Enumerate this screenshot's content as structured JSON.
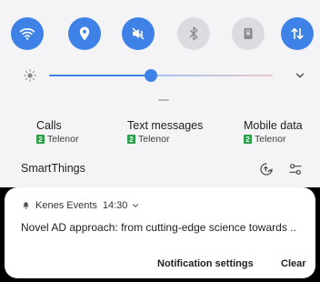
{
  "quick_toggles": [
    {
      "icon": "wifi-icon",
      "state": "on"
    },
    {
      "icon": "location-icon",
      "state": "on"
    },
    {
      "icon": "mute-icon",
      "state": "on"
    },
    {
      "icon": "bluetooth-icon",
      "state": "off"
    },
    {
      "icon": "lock-icon",
      "state": "off"
    },
    {
      "icon": "data-transfer-icon",
      "state": "on"
    }
  ],
  "brightness": {
    "level": 0.45
  },
  "carriers": [
    {
      "title": "Calls",
      "sim": "2",
      "network": "Telenor"
    },
    {
      "title": "Text messages",
      "sim": "2",
      "network": "Telenor"
    },
    {
      "title": "Mobile data",
      "sim": "2",
      "network": "Telenor"
    }
  ],
  "smartthings": {
    "label": "SmartThings"
  },
  "notification": {
    "app": "Kenes Events",
    "time": "14:30",
    "text": "Novel AD approach: from cutting-edge science towards ..",
    "settings_label": "Notification settings",
    "clear_label": "Clear"
  },
  "colors": {
    "accent": "#3e82e8",
    "toggle_off": "#dcdce0",
    "sim_badge": "#2e9f4a"
  }
}
